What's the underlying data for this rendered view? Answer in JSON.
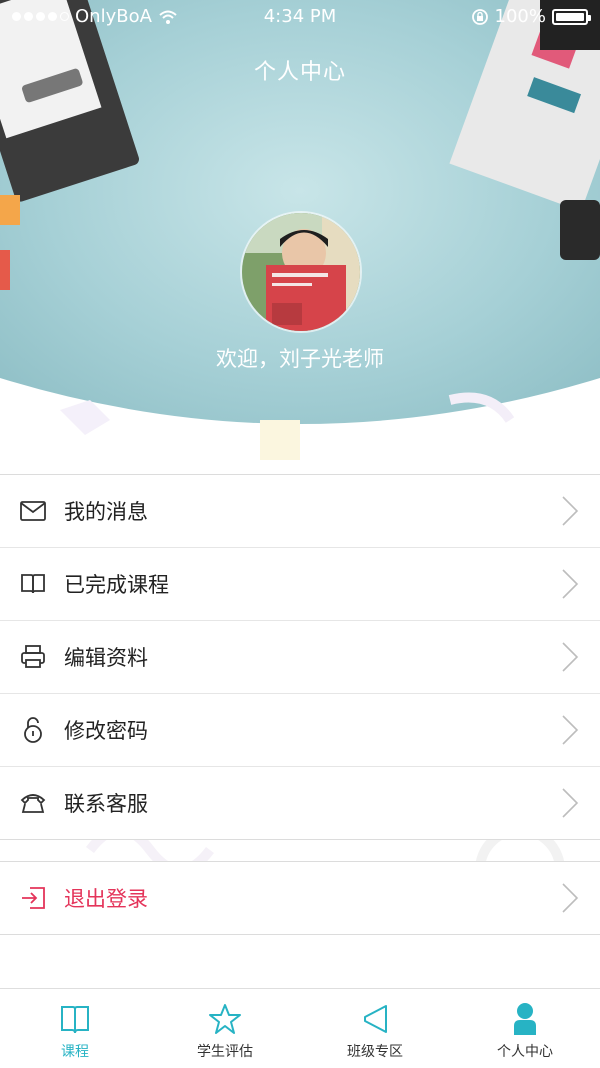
{
  "status": {
    "carrier": "OnlyBoA",
    "time": "4:34 PM",
    "battery": "100%"
  },
  "header": {
    "title": "个人中心",
    "welcome": "欢迎，刘子光老师"
  },
  "menu": [
    {
      "id": "messages",
      "label": "我的消息",
      "icon": "mail-icon"
    },
    {
      "id": "completed-courses",
      "label": "已完成课程",
      "icon": "book-icon"
    },
    {
      "id": "edit-profile",
      "label": "编辑资料",
      "icon": "printer-icon"
    },
    {
      "id": "change-password",
      "label": "修改密码",
      "icon": "lock-icon"
    },
    {
      "id": "contact-service",
      "label": "联系客服",
      "icon": "phone-icon"
    }
  ],
  "logout": {
    "label": "退出登录",
    "icon": "logout-icon"
  },
  "tabs": [
    {
      "label": "课程",
      "icon": "book-open-icon",
      "active": true
    },
    {
      "label": "学生评估",
      "icon": "star-icon",
      "active": false
    },
    {
      "label": "班级专区",
      "icon": "megaphone-icon",
      "active": false
    },
    {
      "label": "个人中心",
      "icon": "person-icon",
      "active": false
    }
  ],
  "colors": {
    "accent": "#27b3c4",
    "danger": "#e4345a",
    "header_bg": "#a9d3d8"
  }
}
